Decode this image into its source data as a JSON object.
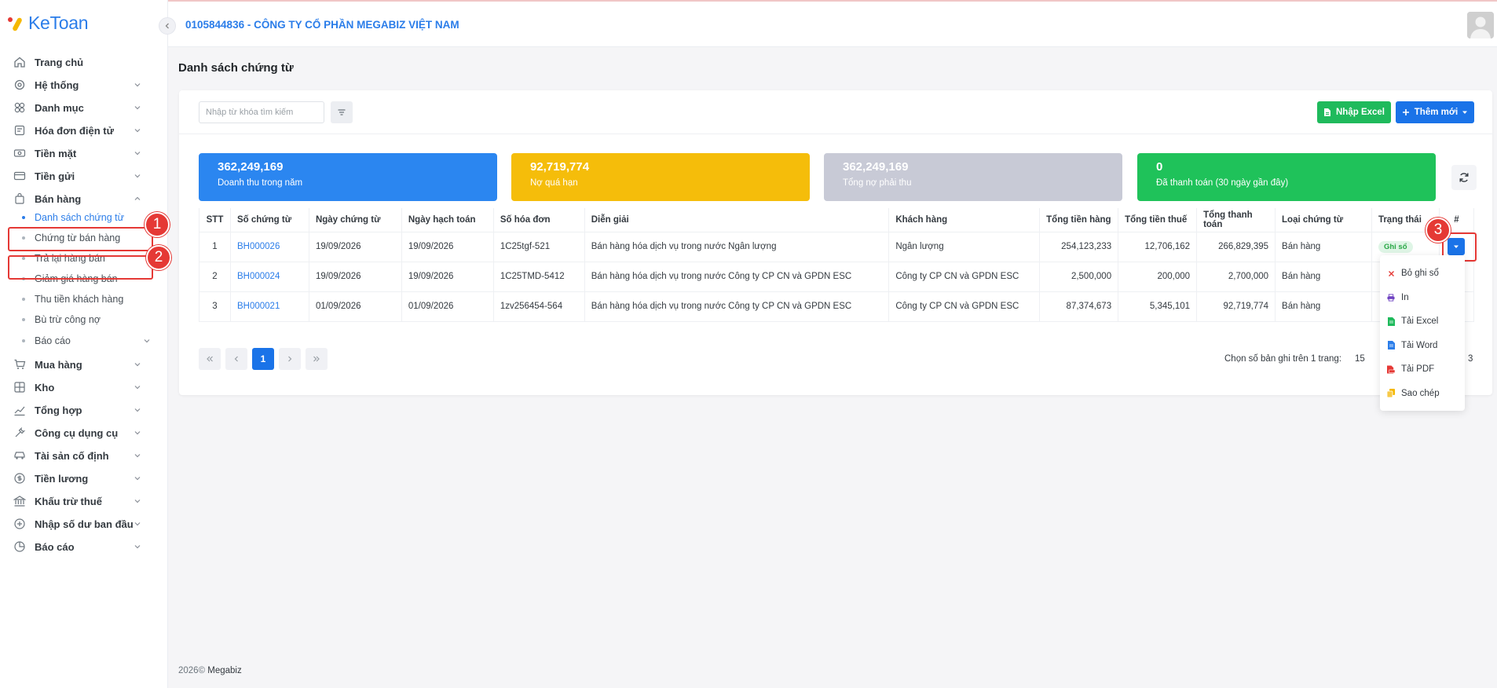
{
  "app": {
    "logo_text": "KeToan",
    "company": "0105844836 - CÔNG TY CỔ PHẦN MEGABIZ VIỆT NAM"
  },
  "sidebar": {
    "items": [
      {
        "label": "Trang chủ",
        "icon": "home-icon"
      },
      {
        "label": "Hệ thống",
        "icon": "settings-icon"
      },
      {
        "label": "Danh mục",
        "icon": "grid-icon"
      },
      {
        "label": "Hóa đơn điện tử",
        "icon": "invoice-icon"
      },
      {
        "label": "Tiền mặt",
        "icon": "cash-icon"
      },
      {
        "label": "Tiền gửi",
        "icon": "card-icon"
      },
      {
        "label": "Bán hàng",
        "icon": "bag-icon"
      },
      {
        "label": "Mua hàng",
        "icon": "cart-icon"
      },
      {
        "label": "Kho",
        "icon": "warehouse-icon"
      },
      {
        "label": "Tổng hợp",
        "icon": "chart-icon"
      },
      {
        "label": "Công cụ dụng cụ",
        "icon": "tools-icon"
      },
      {
        "label": "Tài sản cố định",
        "icon": "car-icon"
      },
      {
        "label": "Tiền lương",
        "icon": "salary-icon"
      },
      {
        "label": "Khấu trừ thuế",
        "icon": "bank-icon"
      },
      {
        "label": "Nhập số dư ban đầu",
        "icon": "balance-icon"
      },
      {
        "label": "Báo cáo",
        "icon": "report-icon"
      }
    ],
    "sub_items": [
      "Danh sách chứng từ",
      "Chứng từ bán hàng",
      "Trả lại hàng bán",
      "Giảm giá hàng bán",
      "Thu tiền khách hàng",
      "Bù trừ công nợ",
      "Báo cáo"
    ],
    "annotations": [
      "1",
      "2",
      "3"
    ]
  },
  "page": {
    "title": "Danh sách chứng từ"
  },
  "toolbar": {
    "search_placeholder": "Nhập từ khóa tìm kiếm",
    "import_excel": "Nhập Excel",
    "add_new": "Thêm mới"
  },
  "stats": [
    {
      "value": "362,249,169",
      "label": "Doanh thu trong năm",
      "color": "#2b86f0"
    },
    {
      "value": "92,719,774",
      "label": "Nợ quá hạn",
      "color": "#f5bd0a"
    },
    {
      "value": "362,249,169",
      "label": "Tổng nợ phải thu",
      "color": "#c8cad6"
    },
    {
      "value": "0",
      "label": "Đã thanh toán (30 ngày gần đây)",
      "color": "#1fc25a"
    }
  ],
  "table": {
    "headers": [
      "STT",
      "Số chứng từ",
      "Ngày chứng từ",
      "Ngày hạch toán",
      "Số hóa đơn",
      "Diễn giải",
      "Khách hàng",
      "Tổng tiền hàng",
      "Tổng tiền thuế",
      "Tổng thanh toán",
      "Loại chứng từ",
      "Trạng thái",
      "#"
    ],
    "rows": [
      [
        "1",
        "BH000026",
        "19/09/2026",
        "19/09/2026",
        "1C25tgf-521",
        "Bán hàng hóa dịch vụ trong nước Ngân lượng",
        "Ngân lượng",
        "254,123,233",
        "12,706,162",
        "266,829,395",
        "Bán hàng",
        "Ghi sổ"
      ],
      [
        "2",
        "BH000024",
        "19/09/2026",
        "19/09/2026",
        "1C25TMD-5412",
        "Bán hàng hóa dịch vụ trong nước Công ty CP CN và GPDN ESC",
        "Công ty CP CN và GPDN ESC",
        "2,500,000",
        "200,000",
        "2,700,000",
        "Bán hàng",
        ""
      ],
      [
        "3",
        "BH000021",
        "01/09/2026",
        "01/09/2026",
        "1zv256454-564",
        "Bán hàng hóa dịch vụ trong nước Công ty CP CN và GPDN ESC",
        "Công ty CP CN và GPDN ESC",
        "87,374,673",
        "5,345,101",
        "92,719,774",
        "Bán hàng",
        ""
      ]
    ]
  },
  "pagination": {
    "current": "1",
    "per_page_label": "Chọn số bản ghi trên 1 trang:",
    "per_page": "15",
    "total": "3"
  },
  "dropdown": {
    "items": [
      {
        "label": "Bỏ ghi sổ",
        "icon": "close-icon",
        "color": "#e53935"
      },
      {
        "label": "In",
        "icon": "print-icon",
        "color": "#6f42c1"
      },
      {
        "label": "Tải Excel",
        "icon": "excel-file-icon",
        "color": "#1fba5c"
      },
      {
        "label": "Tải Word",
        "icon": "word-file-icon",
        "color": "#2b7de9"
      },
      {
        "label": "Tải PDF",
        "icon": "pdf-file-icon",
        "color": "#e53935"
      },
      {
        "label": "Sao chép",
        "icon": "copy-icon",
        "color": "#f5b800"
      }
    ]
  },
  "footer": {
    "year": "2026©",
    "brand": "Megabiz"
  }
}
